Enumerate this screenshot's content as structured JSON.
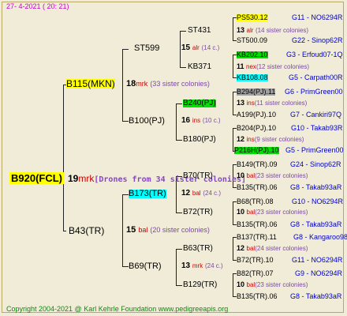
{
  "header": {
    "date": "27-  4-2021 ( 20: 21)"
  },
  "footer": {
    "copyright": "Copyright 2004-2021 @ Karl Kehrle Foundation   www.pedigreeapis.org"
  },
  "root": {
    "name": "B920(FCL)",
    "num": "19",
    "abbr": "mrk",
    "note": "[Drones from 34 sister colonies]"
  },
  "level1": [
    {
      "name": "B115(MKN)",
      "num": "18",
      "abbr": "mrk",
      "note": "(33 sister colonies)"
    },
    {
      "name": "B43(TR)",
      "num": "15",
      "abbr": "bal",
      "note": "(20 sister colonies)"
    }
  ],
  "level2": [
    {
      "name": "ST599",
      "num": "15",
      "abbr": "alr",
      "note": "(14 c.)"
    },
    {
      "name": "B100(PJ)",
      "num": "16",
      "abbr": "ins",
      "note": "(10 c.)"
    },
    {
      "name": "B173(TR)",
      "num": "12",
      "abbr": "bal",
      "note": "(24 c.)"
    },
    {
      "name": "B69(TR)",
      "num": "13",
      "abbr": "mrk",
      "note": "(24 c.)"
    }
  ],
  "level3": [
    {
      "name": "ST431",
      "num": "13",
      "abbr": "alr",
      "note": "(14 sister colonies)"
    },
    {
      "name": "KB371",
      "num": "11",
      "abbr": "nex",
      "note": "(12 sister colonies)"
    },
    {
      "name": "B240(PJ)",
      "num": "13",
      "abbr": "ins",
      "note": "(11 sister colonies)"
    },
    {
      "name": "B180(PJ)",
      "num": "12",
      "abbr": "ins",
      "note": "(9 sister colonies)"
    },
    {
      "name": "B70(TR)",
      "num": "10",
      "abbr": "bal",
      "note": "(23 sister colonies)"
    },
    {
      "name": "B72(TR)",
      "num": "10",
      "abbr": "bal",
      "note": "(23 sister colonies)"
    },
    {
      "name": "B63(TR)",
      "num": "12",
      "abbr": "bal",
      "note": "(24 sister colonies)"
    },
    {
      "name": "B129(TR)",
      "num": "10",
      "abbr": "bal",
      "note": "(23 sister colonies)"
    }
  ],
  "level4": [
    {
      "name": "PS530.12",
      "info": "G11 - NO6294R"
    },
    {
      "name": "ST500.09",
      "info": "G22 - Sinop62R"
    },
    {
      "name": "KB202.10",
      "info": "G3 - Erfoud07-1Q"
    },
    {
      "name": "KB108.08",
      "info": "G5 - Carpath00R"
    },
    {
      "name": "B294(PJ).11",
      "info": "G6 - PrimGreen00"
    },
    {
      "name": "A199(PJ).10",
      "info": "G7 - Cankiri97Q"
    },
    {
      "name": "B204(PJ).10",
      "info": "G10 - Takab93R"
    },
    {
      "name": "P216H(PJ).10",
      "info": "G5 - PrimGreen00"
    },
    {
      "name": "B149(TR).09",
      "info": "G24 - Sinop62R"
    },
    {
      "name": "B135(TR).06",
      "info": "G8 - Takab93aR"
    },
    {
      "name": "B68(TR).08",
      "info": "G10 - NO6294R"
    },
    {
      "name": "B135(TR).06",
      "info": "G8 - Takab93aR"
    },
    {
      "name": "B137(TR).11",
      "info": "G8 - Kangaroo98R"
    },
    {
      "name": "B72(TR).10",
      "info": "G11 - NO6294R"
    },
    {
      "name": "B82(TR).07",
      "info": "G9 - NO6294R"
    },
    {
      "name": "B135(TR).06",
      "info": "G8 - Takab93aR"
    }
  ]
}
